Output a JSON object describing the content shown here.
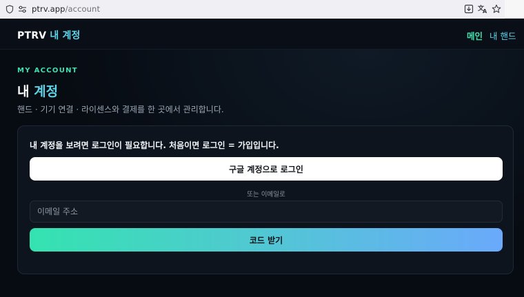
{
  "browser": {
    "url_host": "ptrv.app",
    "url_path": "/account",
    "icons": [
      "shield-icon",
      "permissions-icon",
      "download-icon",
      "translate-icon",
      "bookmark-star-icon"
    ]
  },
  "header": {
    "brand_main": "PTRV",
    "brand_sub": "내 계정",
    "nav": [
      {
        "label": "메인",
        "color": "#3fe0b0"
      },
      {
        "label": "내 핸드",
        "color": "#5fd3e8"
      }
    ]
  },
  "page": {
    "eyebrow": "MY ACCOUNT",
    "title_part1": "내",
    "title_part2": "계정",
    "subtitle": "핸드 · 기기 연결 · 라이센스와 결제를 한 곳에서 관리합니다."
  },
  "login_card": {
    "message": "내 계정을 보려면 로그인이 필요합니다. 처음이면 로그인 = 가입입니다.",
    "google_button": "구글 계정으로 로그인",
    "divider": "또는 이메일로",
    "email_placeholder": "이메일 주소",
    "email_value": "",
    "code_button": "코드 받기"
  },
  "colors": {
    "accent_green": "#3fe0b0",
    "accent_cyan": "#5fd3e8",
    "gradient_end": "#6aa9fb",
    "background": "#070b12"
  }
}
